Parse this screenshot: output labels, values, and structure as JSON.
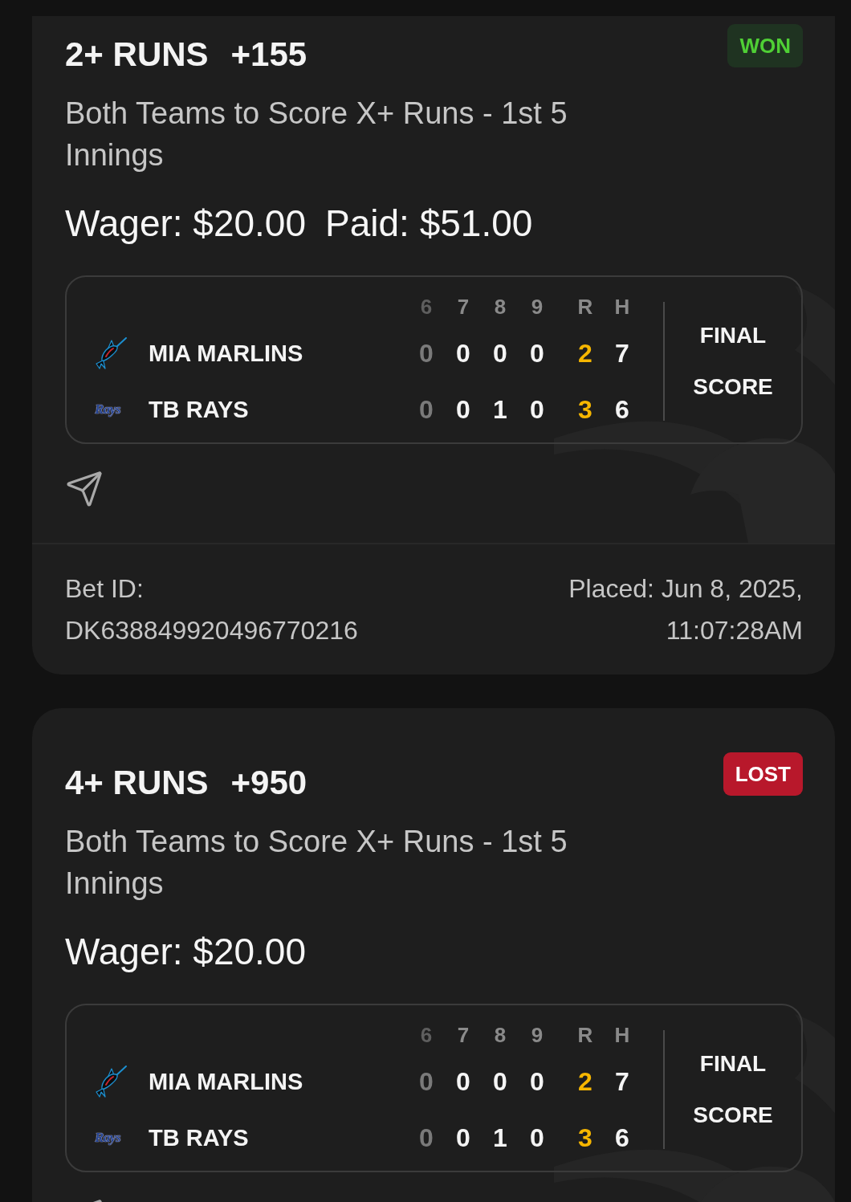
{
  "bets": [
    {
      "selection": "2+ RUNS",
      "odds": "+155",
      "won": true,
      "result_label": "WON",
      "market": "Both Teams to Score X+ Runs - 1st 5 Innings",
      "amounts": [
        "Wager: $20.00",
        "Paid: $51.00"
      ],
      "scoreboard": {
        "columns": [
          {
            "label": "6",
            "kind": "inning",
            "faded": true,
            "highlight": false
          },
          {
            "label": "7",
            "kind": "inning",
            "faded": false,
            "highlight": false
          },
          {
            "label": "8",
            "kind": "inning",
            "faded": false,
            "highlight": false
          },
          {
            "label": "9",
            "kind": "inning",
            "faded": false,
            "highlight": false
          },
          {
            "label": "R",
            "kind": "total",
            "faded": false,
            "highlight": true
          },
          {
            "label": "H",
            "kind": "total",
            "faded": false,
            "highlight": false
          }
        ],
        "teams": [
          {
            "name": "MIA MARLINS",
            "logo": {
              "kind": "fish"
            },
            "scores": [
              "0",
              "0",
              "0",
              "0",
              "2",
              "7"
            ]
          },
          {
            "name": "TB RAYS",
            "logo": {
              "kind": "wordmark",
              "text": "Rays"
            },
            "scores": [
              "0",
              "0",
              "1",
              "0",
              "3",
              "6"
            ]
          }
        ],
        "status": "FINAL SCORE"
      },
      "bet_id": "Bet ID: DK638849920496770216",
      "placed": "Placed: Jun 8, 2025, 11:07:28AM"
    },
    {
      "selection": "4+ RUNS",
      "odds": "+950",
      "won": false,
      "result_label": "LOST",
      "market": "Both Teams to Score X+ Runs - 1st 5 Innings",
      "amounts": [
        "Wager: $20.00"
      ],
      "scoreboard": {
        "columns": [
          {
            "label": "6",
            "kind": "inning",
            "faded": true,
            "highlight": false
          },
          {
            "label": "7",
            "kind": "inning",
            "faded": false,
            "highlight": false
          },
          {
            "label": "8",
            "kind": "inning",
            "faded": false,
            "highlight": false
          },
          {
            "label": "9",
            "kind": "inning",
            "faded": false,
            "highlight": false
          },
          {
            "label": "R",
            "kind": "total",
            "faded": false,
            "highlight": true
          },
          {
            "label": "H",
            "kind": "total",
            "faded": false,
            "highlight": false
          }
        ],
        "teams": [
          {
            "name": "MIA MARLINS",
            "logo": {
              "kind": "fish"
            },
            "scores": [
              "0",
              "0",
              "0",
              "0",
              "2",
              "7"
            ]
          },
          {
            "name": "TB RAYS",
            "logo": {
              "kind": "wordmark",
              "text": "Rays"
            },
            "scores": [
              "0",
              "0",
              "1",
              "0",
              "3",
              "6"
            ]
          }
        ],
        "status": "FINAL SCORE"
      }
    }
  ]
}
